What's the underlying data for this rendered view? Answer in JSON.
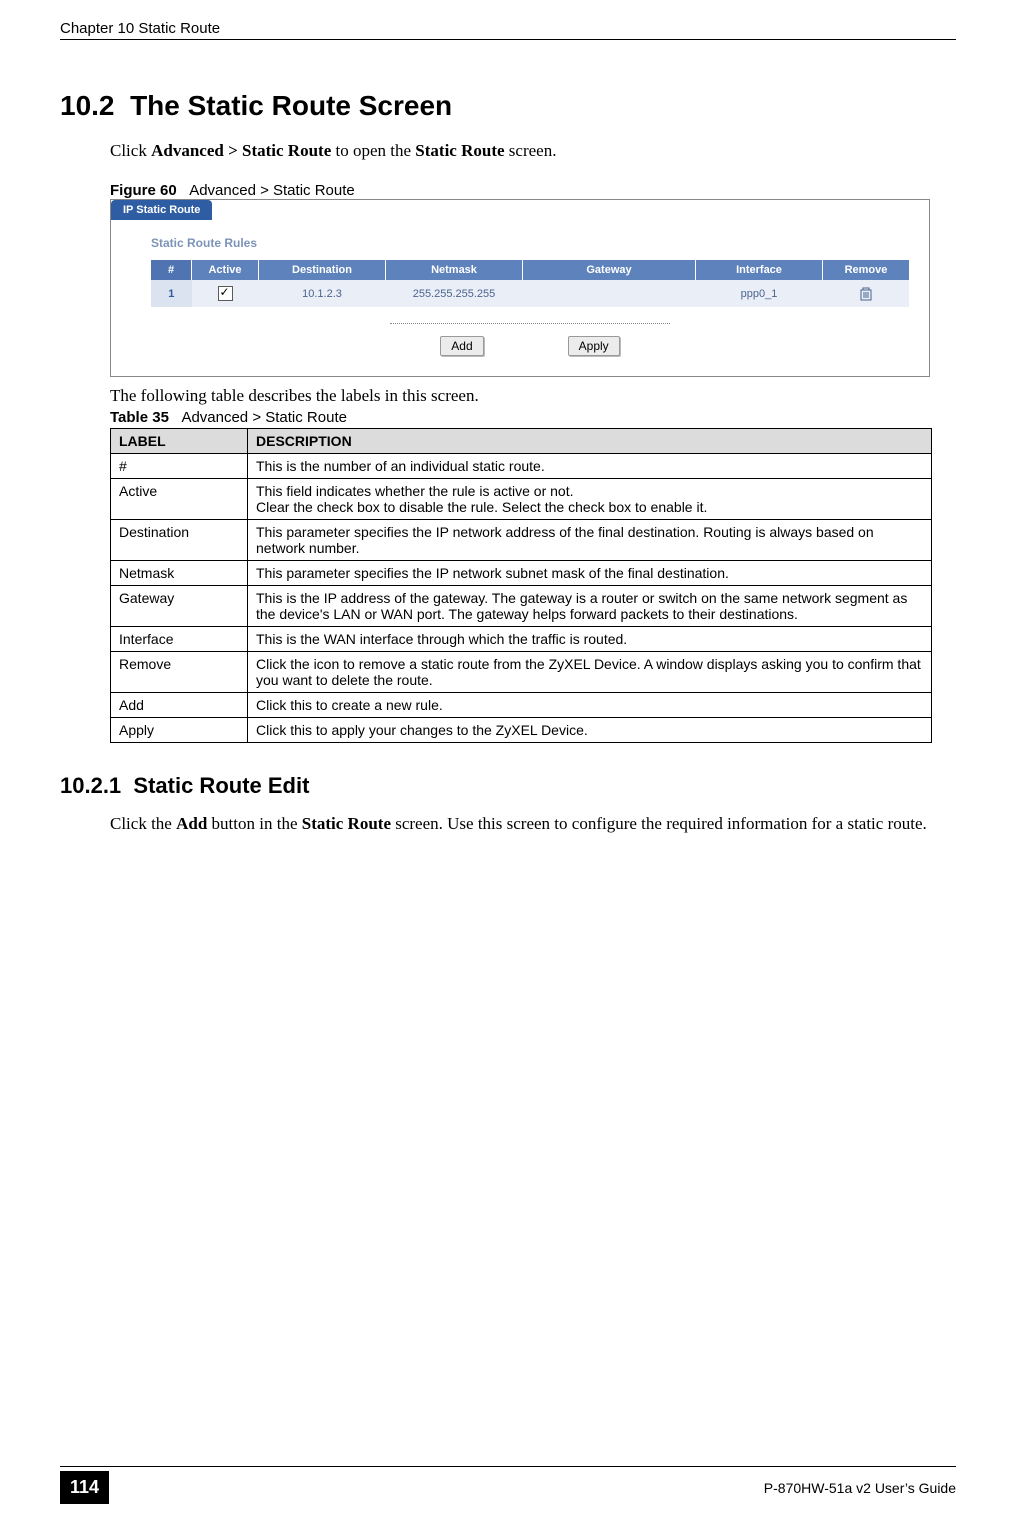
{
  "header": {
    "chapter": "Chapter 10 Static Route"
  },
  "section": {
    "number": "10.2",
    "title": "The Static Route Screen",
    "intro_prefix": "Click ",
    "intro_bold1": "Advanced > Static Route",
    "intro_mid": " to open the ",
    "intro_bold2": "Static Route",
    "intro_suffix": " screen."
  },
  "figure": {
    "label": "Figure 60",
    "caption": "Advanced > Static Route"
  },
  "screenshot": {
    "tab": "IP Static Route",
    "section_title": "Static Route Rules",
    "headers": [
      "#",
      "Active",
      "Destination",
      "Netmask",
      "Gateway",
      "Interface",
      "Remove"
    ],
    "row": {
      "index": "1",
      "active": true,
      "destination": "10.1.2.3",
      "netmask": "255.255.255.255",
      "gateway": "",
      "interface": "ppp0_1",
      "remove_icon": "trash-icon"
    },
    "buttons": {
      "add": "Add",
      "apply": "Apply"
    }
  },
  "table_intro": "The following table describes the labels in this screen.",
  "table": {
    "label": "Table 35",
    "caption": "Advanced > Static Route",
    "head_label": "LABEL",
    "head_desc": "DESCRIPTION",
    "rows": [
      {
        "label": "#",
        "desc": "This is the number of an individual static route."
      },
      {
        "label": "Active",
        "desc": "This field indicates whether the rule is active or not.\nClear the check box to disable the rule. Select the check box to enable it."
      },
      {
        "label": "Destination",
        "desc": "This parameter specifies the IP network address of the final destination. Routing is always based on network number."
      },
      {
        "label": "Netmask",
        "desc": "This parameter specifies the IP network subnet mask of the final destination."
      },
      {
        "label": "Gateway",
        "desc": "This is the IP address of the gateway. The gateway is a router or switch on the same network segment as the device's LAN or WAN port. The gateway helps forward packets to their destinations."
      },
      {
        "label": "Interface",
        "desc": "This is the WAN interface through which the traffic is routed."
      },
      {
        "label": "Remove",
        "desc": "Click the icon to remove a static route from the ZyXEL Device. A window displays asking you to confirm that you want to delete the route."
      },
      {
        "label": "Add",
        "desc": "Click this to create a new rule."
      },
      {
        "label": "Apply",
        "desc": "Click this to apply your changes to the ZyXEL Device."
      }
    ]
  },
  "subsection": {
    "number": "10.2.1",
    "title": "Static Route Edit",
    "para_prefix": "Click the ",
    "para_bold1": "Add",
    "para_mid1": " button in the ",
    "para_bold2": "Static Route",
    "para_suffix": " screen. Use this screen to configure the required information for a static route."
  },
  "footer": {
    "page": "114",
    "guide": "P-870HW-51a v2 User’s Guide"
  }
}
